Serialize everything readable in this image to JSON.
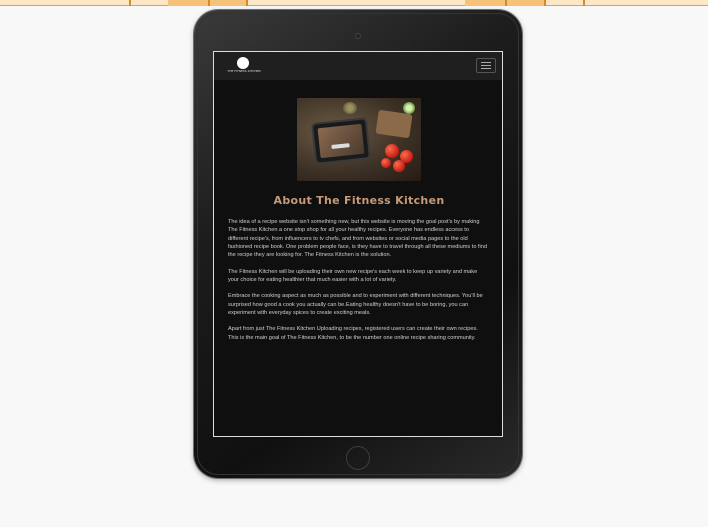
{
  "site": {
    "logo_text": "THE FITNESS KITCHEN"
  },
  "about": {
    "title": "About The Fitness Kitchen",
    "paragraphs": [
      "The idea of a recipe website isn't something new, but this website is moving the goal post's by making The Fitness Kitchen a one stop shop for all your healthy recipes. Everyone has endless access to different recipe's, from influencers to tv chefs, and from websites or social media pages to the old fashioned recipe book. One problem people face, is they have to travel through all these mediums to find the recipe they are looking for. The Fitness Kitchen is the solution.",
      "The Fitness Kitchen will be uploading their own new recipe's each week to keep up variety and make your choice for eating healthier that much easier with a lot of variety.",
      "Embrace the cooking aspect as much as possible and to experiment with different techniques. You'll be surprised how good a cook you actually can be.Eating healthy doesn't have to be boring, you can experiment with everyday spices to create exciting meals.",
      "Apart from just The Fitness Kitchen Uploading recipes, registered users can create their own recipes. This is the main goal of The Fitness Kitchen, to be the number one online recipe sharing community."
    ]
  },
  "colors": {
    "heading": "#c89a78",
    "screen_bg": "#0f0f0f",
    "navbar_bg": "#1f1f1f"
  },
  "icons": {
    "menu": "hamburger-icon",
    "logo": "logo-icon"
  }
}
